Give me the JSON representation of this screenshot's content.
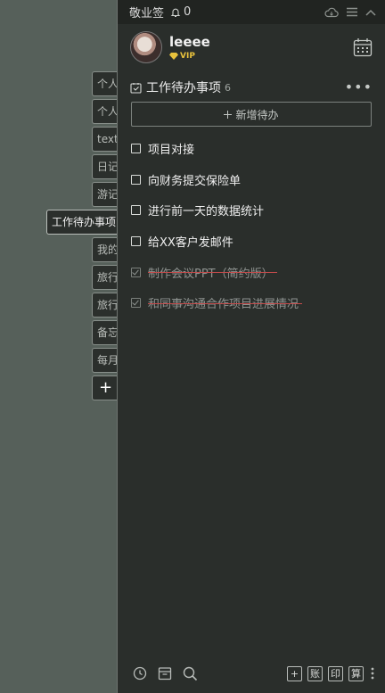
{
  "side_tabs": [
    {
      "label": "个人"
    },
    {
      "label": "个人"
    },
    {
      "label": "text"
    },
    {
      "label": "日记"
    },
    {
      "label": "游记"
    },
    {
      "label": "工作待办事项",
      "active": true
    },
    {
      "label": "我的"
    },
    {
      "label": "旅行"
    },
    {
      "label": "旅行"
    },
    {
      "label": "备忘"
    },
    {
      "label": "每月"
    }
  ],
  "add_tab_label": "+",
  "topbar": {
    "brand": "敬业签",
    "notifications": "0"
  },
  "user": {
    "name": "leeee",
    "badge": "VIP"
  },
  "list": {
    "title": "工作待办事项",
    "count": "6",
    "more": "•••"
  },
  "add_todo_label": "新增待办",
  "todos": [
    {
      "text": "项目对接",
      "done": false
    },
    {
      "text": "向财务提交保险单",
      "done": false
    },
    {
      "text": "进行前一天的数据统计",
      "done": false
    },
    {
      "text": "给XX客户发邮件",
      "done": false
    },
    {
      "text": "制作会议PPT（简约版）",
      "done": true
    },
    {
      "text": "和同事沟通合作项目进展情况",
      "done": true
    }
  ],
  "footer": {
    "buttons": [
      "+",
      "账",
      "印",
      "算"
    ]
  },
  "colors": {
    "background": "#56605a",
    "panel": "#2a2e2b",
    "vip": "#e8c23c",
    "strike": "#c24b4b"
  }
}
